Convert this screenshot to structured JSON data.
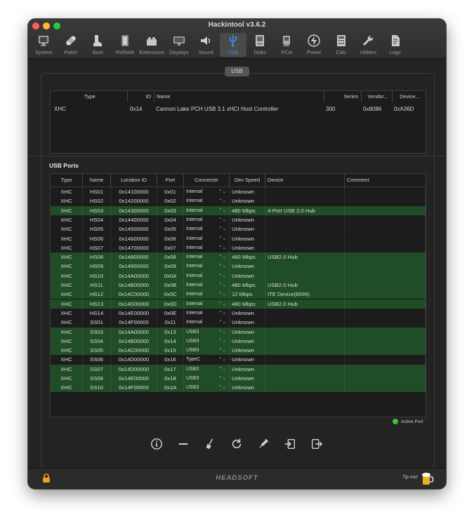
{
  "window": {
    "title": "Hackintool v3.6.2"
  },
  "toolbar": [
    {
      "label": "System",
      "icon": "monitor-icon"
    },
    {
      "label": "Patch",
      "icon": "bandage-icon"
    },
    {
      "label": "Boot",
      "icon": "boot-icon"
    },
    {
      "label": "NVRAM",
      "icon": "memory-chip-icon"
    },
    {
      "label": "Extensions",
      "icon": "lego-brick-icon"
    },
    {
      "label": "Displays",
      "icon": "display-icon"
    },
    {
      "label": "Sound",
      "icon": "speaker-icon"
    },
    {
      "label": "USB",
      "icon": "usb-icon",
      "active": true
    },
    {
      "label": "Disks",
      "icon": "disk-icon"
    },
    {
      "label": "PCIe",
      "icon": "pcie-card-icon"
    },
    {
      "label": "Power",
      "icon": "power-bolt-icon"
    },
    {
      "label": "Calc",
      "icon": "calculator-icon"
    },
    {
      "label": "Utilities",
      "icon": "wrench-icon"
    },
    {
      "label": "Logs",
      "icon": "log-file-icon"
    }
  ],
  "section_tab": "USB",
  "controllers": {
    "columns": [
      "Type",
      "ID",
      "Name",
      "Series",
      "Vendor...",
      "Device..."
    ],
    "rows": [
      {
        "type": "XHC",
        "id": "0x14",
        "name": "Cannon Lake PCH USB 3.1 xHCI Host Controller",
        "series": "300",
        "vendor": "0x8086",
        "device": "0xA36D"
      }
    ]
  },
  "ports": {
    "label": "USB Ports",
    "columns": [
      "Type",
      "Name",
      "Location ID",
      "Port",
      "Connector",
      "Dev Speed",
      "Device",
      "Comment"
    ],
    "rows": [
      {
        "type": "XHC",
        "name": "HS01",
        "loc": "0x14100000",
        "port": "0x01",
        "connector": "Internal",
        "speed": "Unknown",
        "device": "",
        "comment": "",
        "active": false
      },
      {
        "type": "XHC",
        "name": "HS02",
        "loc": "0x14200000",
        "port": "0x02",
        "connector": "Internal",
        "speed": "Unknown",
        "device": "",
        "comment": "",
        "active": false
      },
      {
        "type": "XHC",
        "name": "HS03",
        "loc": "0x14300000",
        "port": "0x03",
        "connector": "Internal",
        "speed": "480 Mbps",
        "device": "4-Port USB 2.0 Hub",
        "comment": "",
        "active": true
      },
      {
        "type": "XHC",
        "name": "HS04",
        "loc": "0x14400000",
        "port": "0x04",
        "connector": "Internal",
        "speed": "Unknown",
        "device": "",
        "comment": "",
        "active": false
      },
      {
        "type": "XHC",
        "name": "HS05",
        "loc": "0x14500000",
        "port": "0x05",
        "connector": "Internal",
        "speed": "Unknown",
        "device": "",
        "comment": "",
        "active": false
      },
      {
        "type": "XHC",
        "name": "HS06",
        "loc": "0x14600000",
        "port": "0x06",
        "connector": "Internal",
        "speed": "Unknown",
        "device": "",
        "comment": "",
        "active": false
      },
      {
        "type": "XHC",
        "name": "HS07",
        "loc": "0x14700000",
        "port": "0x07",
        "connector": "Internal",
        "speed": "Unknown",
        "device": "",
        "comment": "",
        "active": false
      },
      {
        "type": "XHC",
        "name": "HS08",
        "loc": "0x14800000",
        "port": "0x08",
        "connector": "Internal",
        "speed": "480 Mbps",
        "device": "USB2.0 Hub",
        "comment": "",
        "active": true
      },
      {
        "type": "XHC",
        "name": "HS09",
        "loc": "0x14900000",
        "port": "0x09",
        "connector": "Internal",
        "speed": "Unknown",
        "device": "",
        "comment": "",
        "active": true
      },
      {
        "type": "XHC",
        "name": "HS10",
        "loc": "0x14A00000",
        "port": "0x0A",
        "connector": "Internal",
        "speed": "Unknown",
        "device": "",
        "comment": "",
        "active": true
      },
      {
        "type": "XHC",
        "name": "HS11",
        "loc": "0x14B00000",
        "port": "0x0B",
        "connector": "Internal",
        "speed": "480 Mbps",
        "device": "USB2.0 Hub",
        "comment": "",
        "active": true
      },
      {
        "type": "XHC",
        "name": "HS12",
        "loc": "0x14C00000",
        "port": "0x0C",
        "connector": "Internal",
        "speed": "12 Mbps",
        "device": "ITE Device(8595)",
        "comment": "",
        "active": true
      },
      {
        "type": "XHC",
        "name": "HS13",
        "loc": "0x14D00000",
        "port": "0x0D",
        "connector": "Internal",
        "speed": "480 Mbps",
        "device": "USB2.0 Hub",
        "comment": "",
        "active": true
      },
      {
        "type": "XHC",
        "name": "HS14",
        "loc": "0x14E00000",
        "port": "0x0E",
        "connector": "Internal",
        "speed": "Unknown",
        "device": "",
        "comment": "",
        "active": false
      },
      {
        "type": "XHC",
        "name": "SS01",
        "loc": "0x14F00000",
        "port": "0x11",
        "connector": "Internal",
        "speed": "Unknown",
        "device": "",
        "comment": "",
        "active": false
      },
      {
        "type": "XHC",
        "name": "SS03",
        "loc": "0x14A00000",
        "port": "0x13",
        "connector": "USB3",
        "speed": "Unknown",
        "device": "",
        "comment": "",
        "active": true
      },
      {
        "type": "XHC",
        "name": "SS04",
        "loc": "0x14B00000",
        "port": "0x14",
        "connector": "USB3",
        "speed": "Unknown",
        "device": "",
        "comment": "",
        "active": true
      },
      {
        "type": "XHC",
        "name": "SS05",
        "loc": "0x14C00000",
        "port": "0x15",
        "connector": "USB3",
        "speed": "Unknown",
        "device": "",
        "comment": "",
        "active": true
      },
      {
        "type": "XHC",
        "name": "SS06",
        "loc": "0x14D00000",
        "port": "0x16",
        "connector": "TypeC",
        "speed": "Unknown",
        "device": "",
        "comment": "",
        "active": false
      },
      {
        "type": "XHC",
        "name": "SS07",
        "loc": "0x14D00000",
        "port": "0x17",
        "connector": "USB3",
        "speed": "Unknown",
        "device": "",
        "comment": "",
        "active": true
      },
      {
        "type": "XHC",
        "name": "SS08",
        "loc": "0x14E00000",
        "port": "0x18",
        "connector": "USB3",
        "speed": "Unknown",
        "device": "",
        "comment": "",
        "active": true
      },
      {
        "type": "XHC",
        "name": "SS10",
        "loc": "0x14F00000",
        "port": "0x1A",
        "connector": "USB3",
        "speed": "Unknown",
        "device": "",
        "comment": "",
        "active": true
      }
    ]
  },
  "legend": {
    "active_port": "Active Port"
  },
  "actions": [
    {
      "name": "info-button",
      "icon": "info-icon"
    },
    {
      "name": "remove-button",
      "icon": "minus-icon"
    },
    {
      "name": "clear-button",
      "icon": "broom-icon"
    },
    {
      "name": "refresh-button",
      "icon": "refresh-icon"
    },
    {
      "name": "inject-button",
      "icon": "syringe-icon"
    },
    {
      "name": "import-button",
      "icon": "import-icon"
    },
    {
      "name": "export-button",
      "icon": "export-icon"
    }
  ],
  "footer": {
    "brand": "HEADSOFT",
    "tip": "Tip me!"
  },
  "colors": {
    "active_row": "#1f4d25",
    "accent": "#3b8ff0",
    "active_dot": "#3ac23a"
  }
}
